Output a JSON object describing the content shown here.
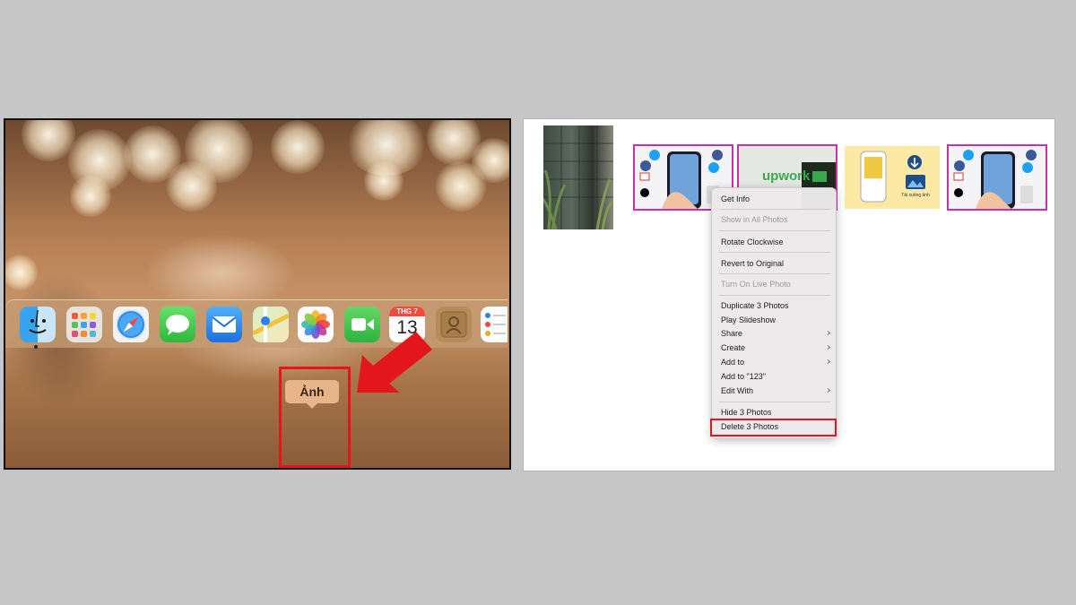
{
  "left": {
    "tooltip_label": "Ảnh",
    "calendar": {
      "month": "THG 7",
      "day": "13"
    },
    "dock_icons": [
      "finder-icon",
      "launchpad-icon",
      "safari-icon",
      "messages-icon",
      "mail-icon",
      "maps-icon",
      "photos-icon",
      "facetime-icon",
      "calendar-icon",
      "contacts-icon",
      "reminders-icon"
    ]
  },
  "right": {
    "thumbnails": [
      {
        "name": "building-plant-photo",
        "selected": false
      },
      {
        "name": "iphone-social-apps-photo",
        "selected": true
      },
      {
        "name": "upwork-photo",
        "selected": true,
        "text": "upwork"
      },
      {
        "name": "phone-download-photo",
        "selected": false,
        "caption": "Tải xuống ảnh"
      },
      {
        "name": "iphone-social-apps-photo-2",
        "selected": true
      }
    ],
    "context_menu": {
      "items": [
        {
          "label": "Get Info",
          "disabled": false
        },
        {
          "label": "Show in All Photos",
          "disabled": true
        },
        {
          "label": "Rotate Clockwise",
          "disabled": false
        },
        {
          "label": "Revert to Original",
          "disabled": false
        },
        {
          "label": "Turn On Live Photo",
          "disabled": true
        },
        {
          "label": "Duplicate 3 Photos",
          "disabled": false
        },
        {
          "label": "Play Slideshow",
          "disabled": false
        },
        {
          "label": "Share",
          "disabled": false,
          "submenu": true
        },
        {
          "label": "Create",
          "disabled": false,
          "submenu": true
        },
        {
          "label": "Add to",
          "disabled": false,
          "submenu": true
        },
        {
          "label": "Add to \"123\"",
          "disabled": false
        },
        {
          "label": "Edit With",
          "disabled": false,
          "submenu": true
        },
        {
          "label": "Hide 3 Photos",
          "disabled": false
        },
        {
          "label": "Delete 3 Photos",
          "disabled": false,
          "highlighted": true
        }
      ],
      "chevron": "›"
    }
  },
  "colors": {
    "highlight_red": "#e3161c",
    "selection_magenta": "#c832a6"
  }
}
